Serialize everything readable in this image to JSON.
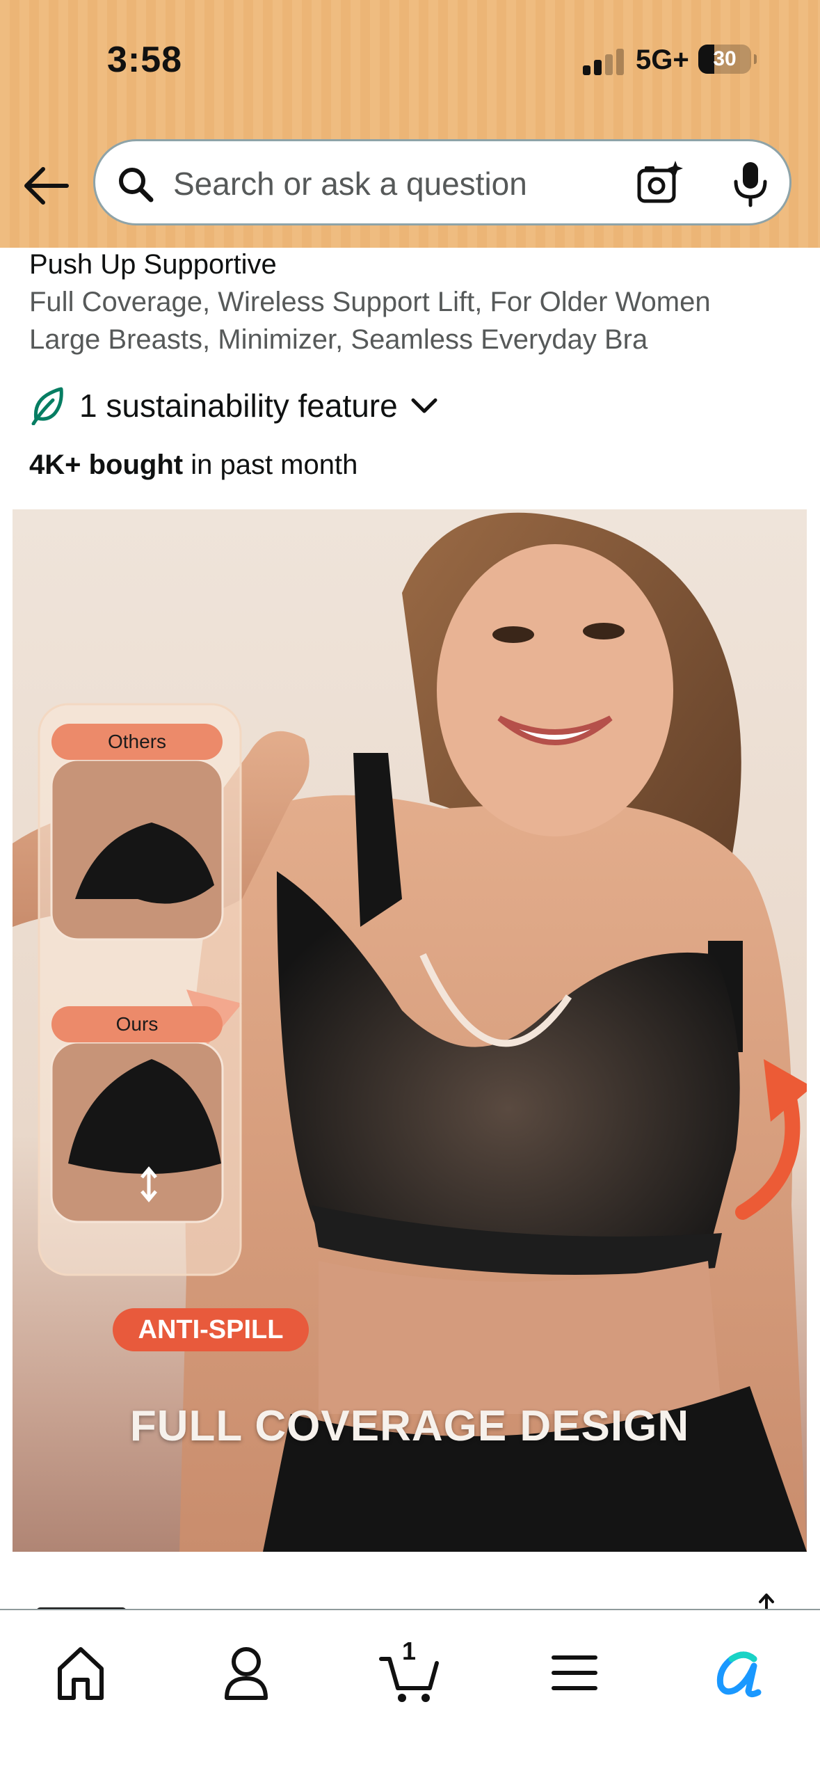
{
  "status_bar": {
    "time": "3:58",
    "network": "5G+",
    "battery": "30",
    "battery_level": 0.3
  },
  "header": {
    "back_icon": "arrow-left-icon",
    "search_placeholder": "Search or ask a question",
    "camera_icon": "camera-sparkle-icon",
    "mic_icon": "microphone-icon",
    "background_color": "#efbc80"
  },
  "product": {
    "title_line1": "Push Up Supportive",
    "title_line2": "Full Coverage, Wireless Support Lift, For Older Women",
    "title_line3": "Large Breasts, Minimizer, Seamless Everyday Bra",
    "sustainability": "1 sustainability feature",
    "bought_bold": "4K+ bought",
    "bought_rest": " in past month"
  },
  "image": {
    "label_others": "Others",
    "label_ours": "Ours",
    "badge": "ANTI-SPILL",
    "caption": "FULL COVERAGE DESIGN"
  },
  "bottom_nav": {
    "items": [
      "home-icon",
      "account-icon",
      "cart-icon",
      "menu-icon",
      "rufus-icon"
    ],
    "cart_count": "1",
    "rufus_color": "#1a98ff"
  }
}
